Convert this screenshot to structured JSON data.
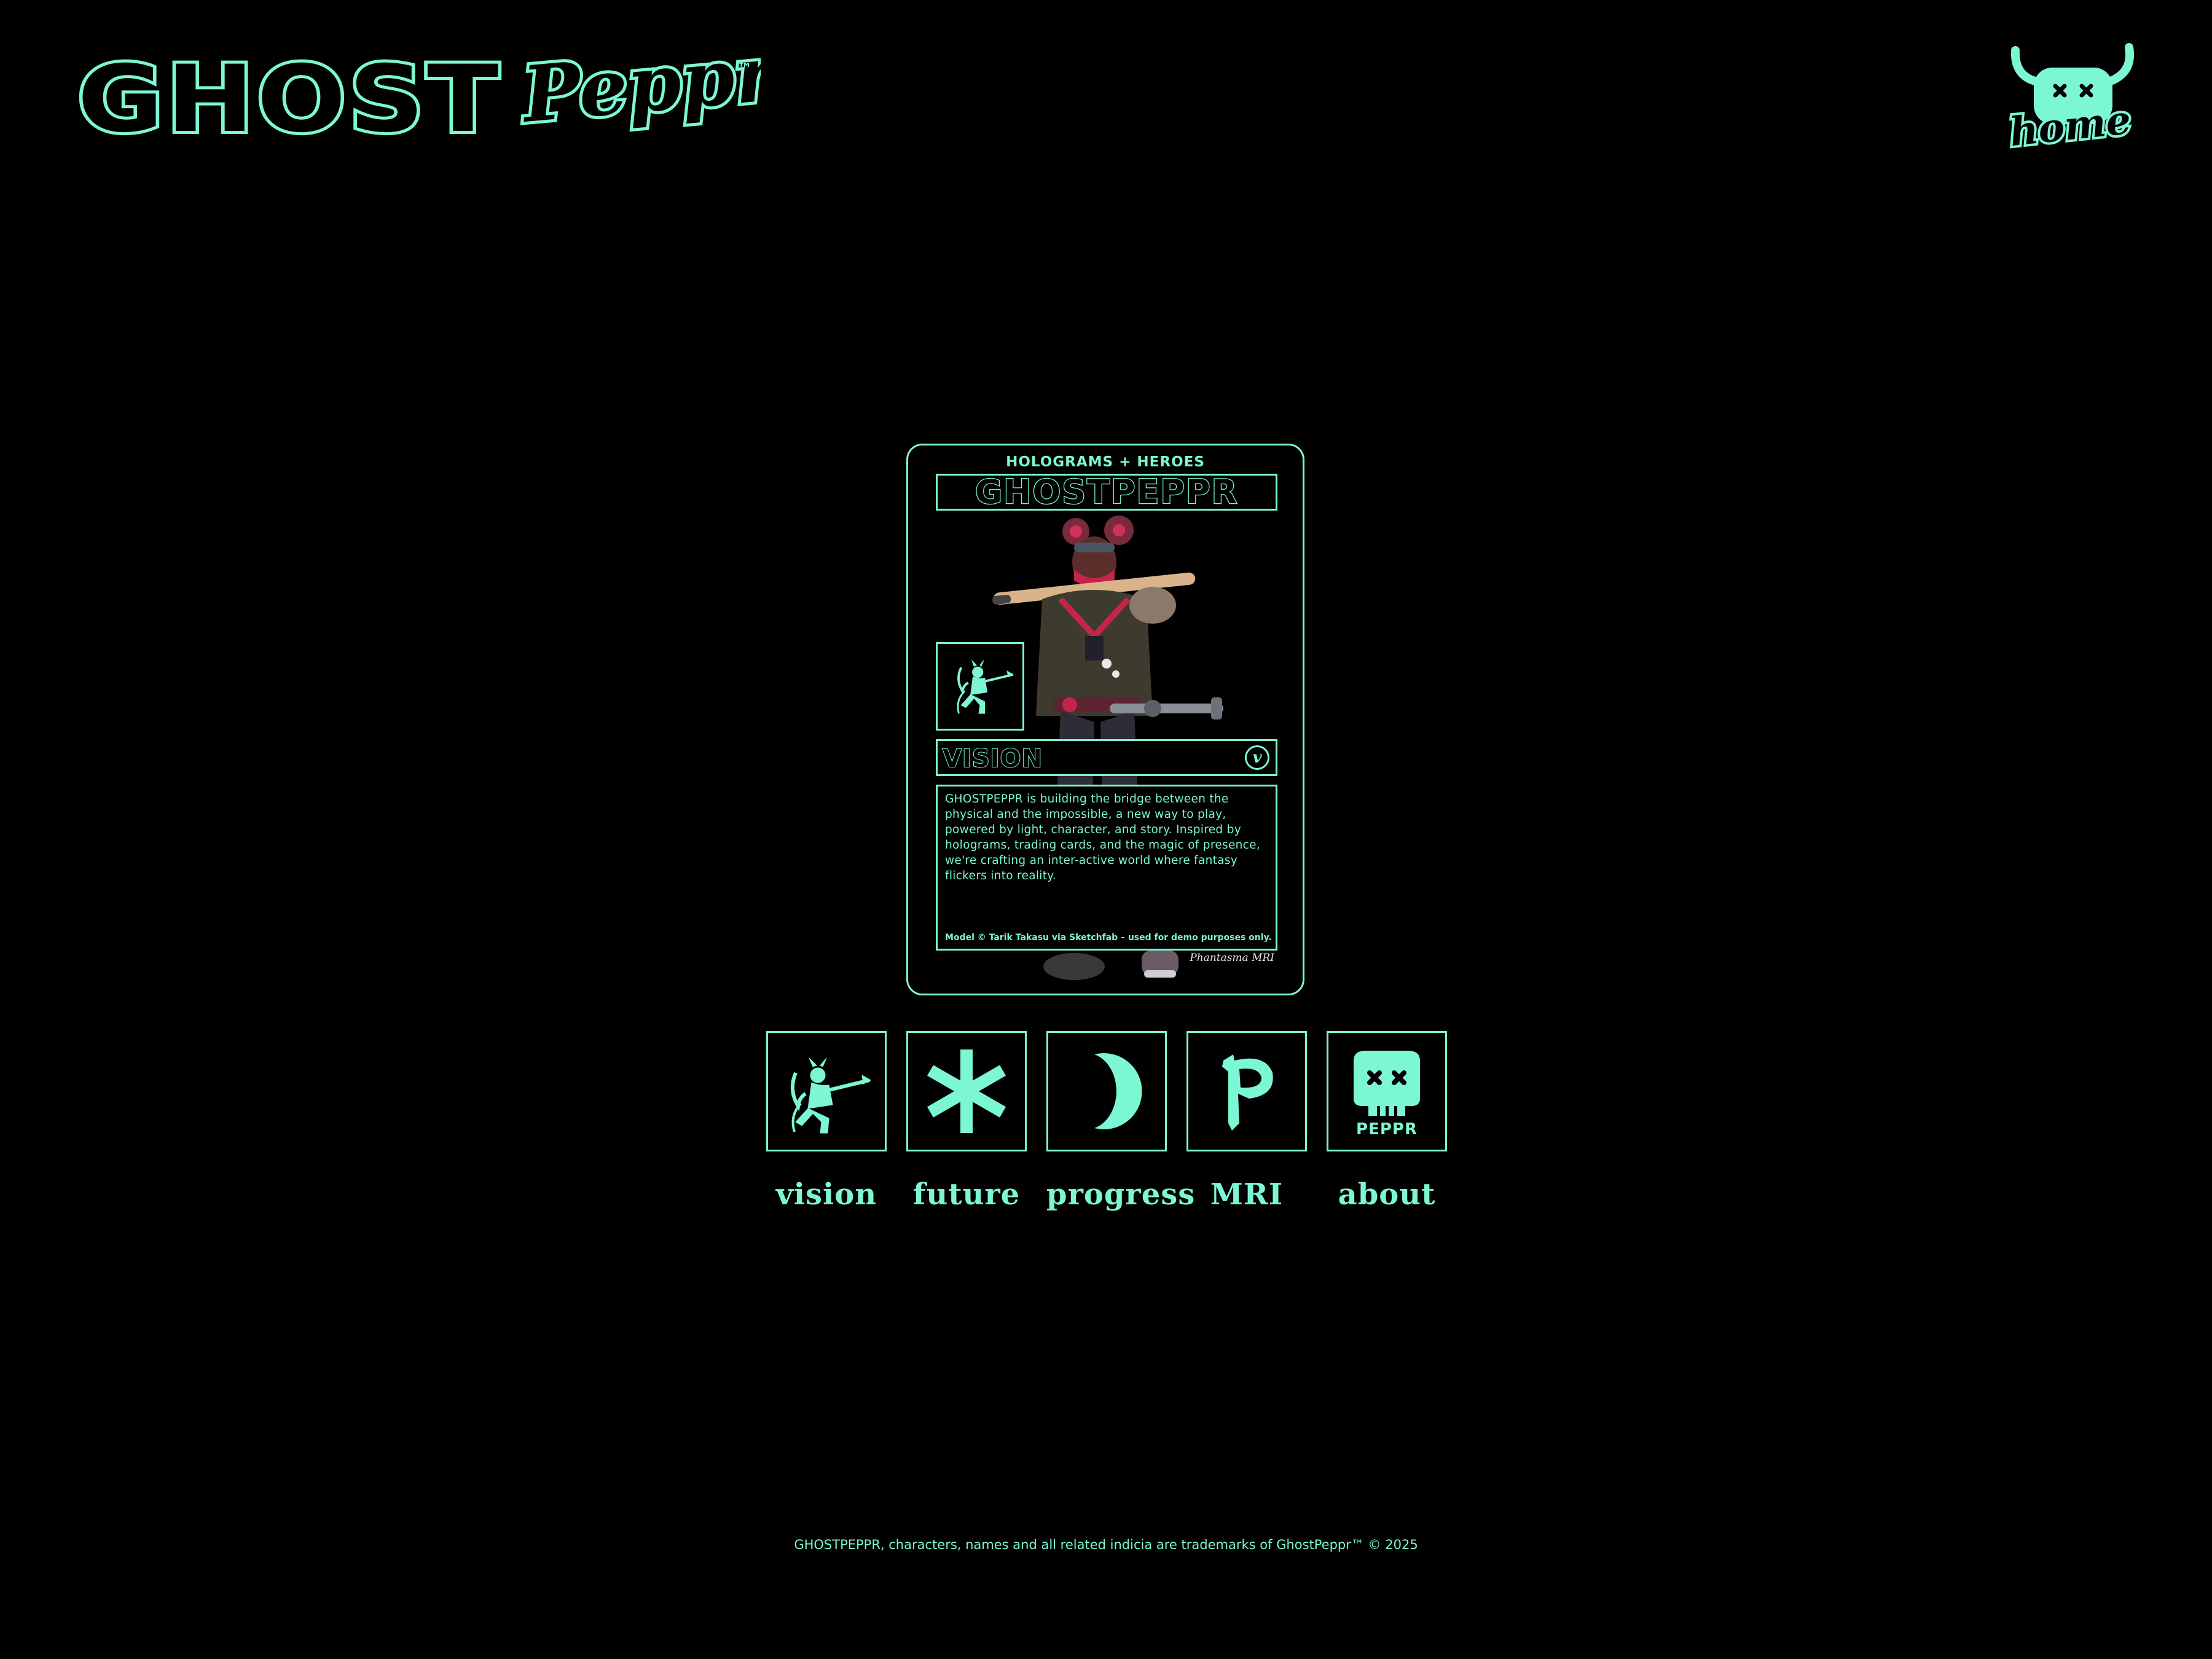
{
  "brand": {
    "logo_main": "GHOST",
    "logo_script": "Peppr",
    "trademark": "™"
  },
  "home": {
    "label": "home"
  },
  "card": {
    "eyebrow": "HOLOGRAMS + HEROES",
    "title": "GHOSTPEPPR",
    "section_label": "VISION",
    "section_badge": "v",
    "description": "GHOSTPEPPR is building the bridge between the physical and the impossible, a new way to play, powered by light, character, and story. Inspired by holograms, trading cards, and the magic of presence, we're crafting an inter-active world where fantasy flickers into reality.",
    "credit": "Model © Tarik Takasu via Sketchfab – used for demo purposes only.",
    "signature": "Phantasma MRI"
  },
  "nav": [
    {
      "label": "vision",
      "icon": "demon-archer-icon"
    },
    {
      "label": "future",
      "icon": "asterisk-icon"
    },
    {
      "label": "progress",
      "icon": "crescent-moon-icon"
    },
    {
      "label": "MRI",
      "icon": "gothic-p-icon"
    },
    {
      "label": "about",
      "icon": "peppr-skull-icon",
      "icon_text": "PEPPR"
    }
  ],
  "footer": "GHOSTPEPPR, characters, names and all related indicia are trademarks of GhostPeppr™ © 2025",
  "colors": {
    "accent": "#7cf7d4",
    "background": "#000000"
  }
}
